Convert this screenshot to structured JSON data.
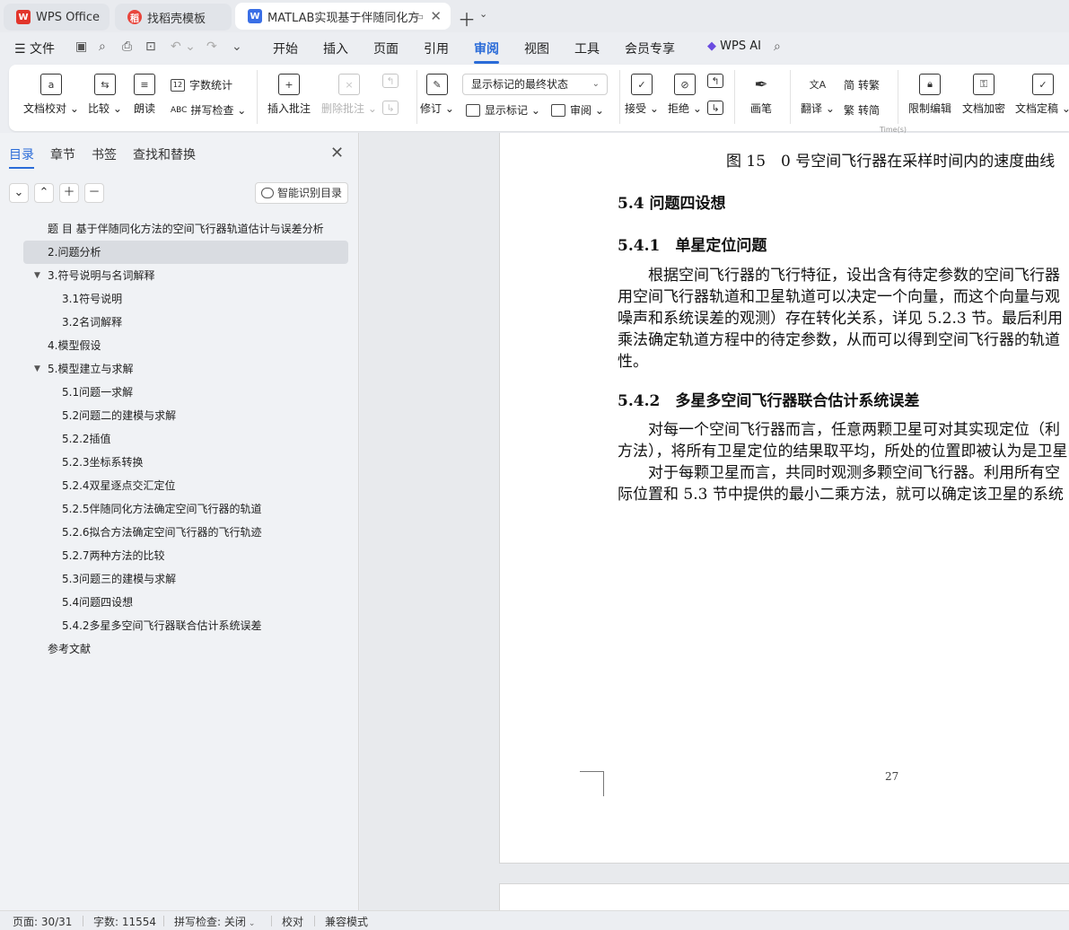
{
  "tabs": [
    {
      "label": "WPS Office",
      "icon": "wps-logo-icon"
    },
    {
      "label": "找稻壳模板",
      "icon": "docer-icon"
    },
    {
      "label": "MATLAB实现基于伴随同化方",
      "icon": "writer-doc-icon"
    }
  ],
  "menu": {
    "file": "文件",
    "items": [
      "开始",
      "插入",
      "页面",
      "引用",
      "审阅",
      "视图",
      "工具",
      "会员专享"
    ],
    "active": "审阅",
    "ai": "WPS AI"
  },
  "ribbon": {
    "doc_check": "文档校对",
    "compare": "比较",
    "read_aloud": "朗读",
    "word_count": "字数统计",
    "spell_check": "拼写检查",
    "insert_comment": "插入批注",
    "delete_comment": "删除批注",
    "revise": "修订",
    "markup_state": "显示标记的最终状态",
    "show_markup": "显示标记",
    "review": "审阅",
    "accept": "接受",
    "reject": "拒绝",
    "pen": "画笔",
    "translate": "翻译",
    "to_traditional": "转繁",
    "to_simplified": "转简",
    "restrict_edit": "限制编辑",
    "encrypt": "文档加密",
    "finalize": "文档定稿"
  },
  "sidebar": {
    "tabs": [
      "目录",
      "章节",
      "书签",
      "查找和替换"
    ],
    "active_tab": "目录",
    "smart_toc": "智能识别目录",
    "toc": [
      {
        "label": "题 目 基于伴随同化方法的空间飞行器轨道估计与误差分析",
        "level": 1,
        "arrow": ""
      },
      {
        "label": "2.问题分析",
        "level": 1,
        "arrow": "",
        "selected": true
      },
      {
        "label": "3.符号说明与名词解释",
        "level": 1,
        "arrow": "▼"
      },
      {
        "label": "3.1符号说明",
        "level": 2,
        "arrow": ""
      },
      {
        "label": "3.2名词解释",
        "level": 2,
        "arrow": ""
      },
      {
        "label": "4.模型假设",
        "level": 1,
        "arrow": ""
      },
      {
        "label": "5.模型建立与求解",
        "level": 1,
        "arrow": "▼"
      },
      {
        "label": "5.1问题一求解",
        "level": 2,
        "arrow": ""
      },
      {
        "label": "5.2问题二的建模与求解",
        "level": 2,
        "arrow": ""
      },
      {
        "label": "5.2.2插值",
        "level": 2,
        "arrow": ""
      },
      {
        "label": "5.2.3坐标系转换",
        "level": 2,
        "arrow": ""
      },
      {
        "label": "5.2.4双星逐点交汇定位",
        "level": 2,
        "arrow": ""
      },
      {
        "label": "5.2.5伴随同化方法确定空间飞行器的轨道",
        "level": 2,
        "arrow": ""
      },
      {
        "label": "5.2.6拟合方法确定空间飞行器的飞行轨迹",
        "level": 2,
        "arrow": ""
      },
      {
        "label": "5.2.7两种方法的比较",
        "level": 2,
        "arrow": ""
      },
      {
        "label": "5.3问题三的建模与求解",
        "level": 2,
        "arrow": ""
      },
      {
        "label": "5.4问题四设想",
        "level": 2,
        "arrow": ""
      },
      {
        "label": "5.4.2多星多空间飞行器联合估计系统误差",
        "level": 2,
        "arrow": ""
      },
      {
        "label": "参考文献",
        "level": 1,
        "arrow": ""
      }
    ]
  },
  "document": {
    "axis_fragment": "Time(s)",
    "figure_caption": "图 15　0 号空间飞行器在采样时间内的速度曲线",
    "h_54": "5.4  问题四设想",
    "h_541": "5.4.1　单星定位问题",
    "p1": [
      "　　根据空间飞行器的飞行特征，设出含有待定参数的空间飞行器",
      "用空间飞行器轨道和卫星轨道可以决定一个向量，而这个向量与观",
      "噪声和系统误差的观测）存在转化关系，详见 5.2.3 节。最后利用",
      "乘法确定轨道方程中的待定参数，从而可以得到空间飞行器的轨道",
      "性。"
    ],
    "h_542": "5.4.2　多星多空间飞行器联合估计系统误差",
    "p2": [
      "　　对每一个空间飞行器而言，任意两颗卫星可对其实现定位（利",
      "方法），将所有卫星定位的结果取平均，所处的位置即被认为是卫星的",
      "　　对于每颗卫星而言，共同时观测多颗空间飞行器。利用所有空",
      "际位置和 5.3 节中提供的最小二乘方法，就可以确定该卫星的系统"
    ],
    "page_number": "27"
  },
  "status": {
    "page": "页面: 30/31",
    "words": "字数: 11554",
    "spell": "拼写检查: 关闭",
    "proof": "校对",
    "compat": "兼容模式"
  }
}
